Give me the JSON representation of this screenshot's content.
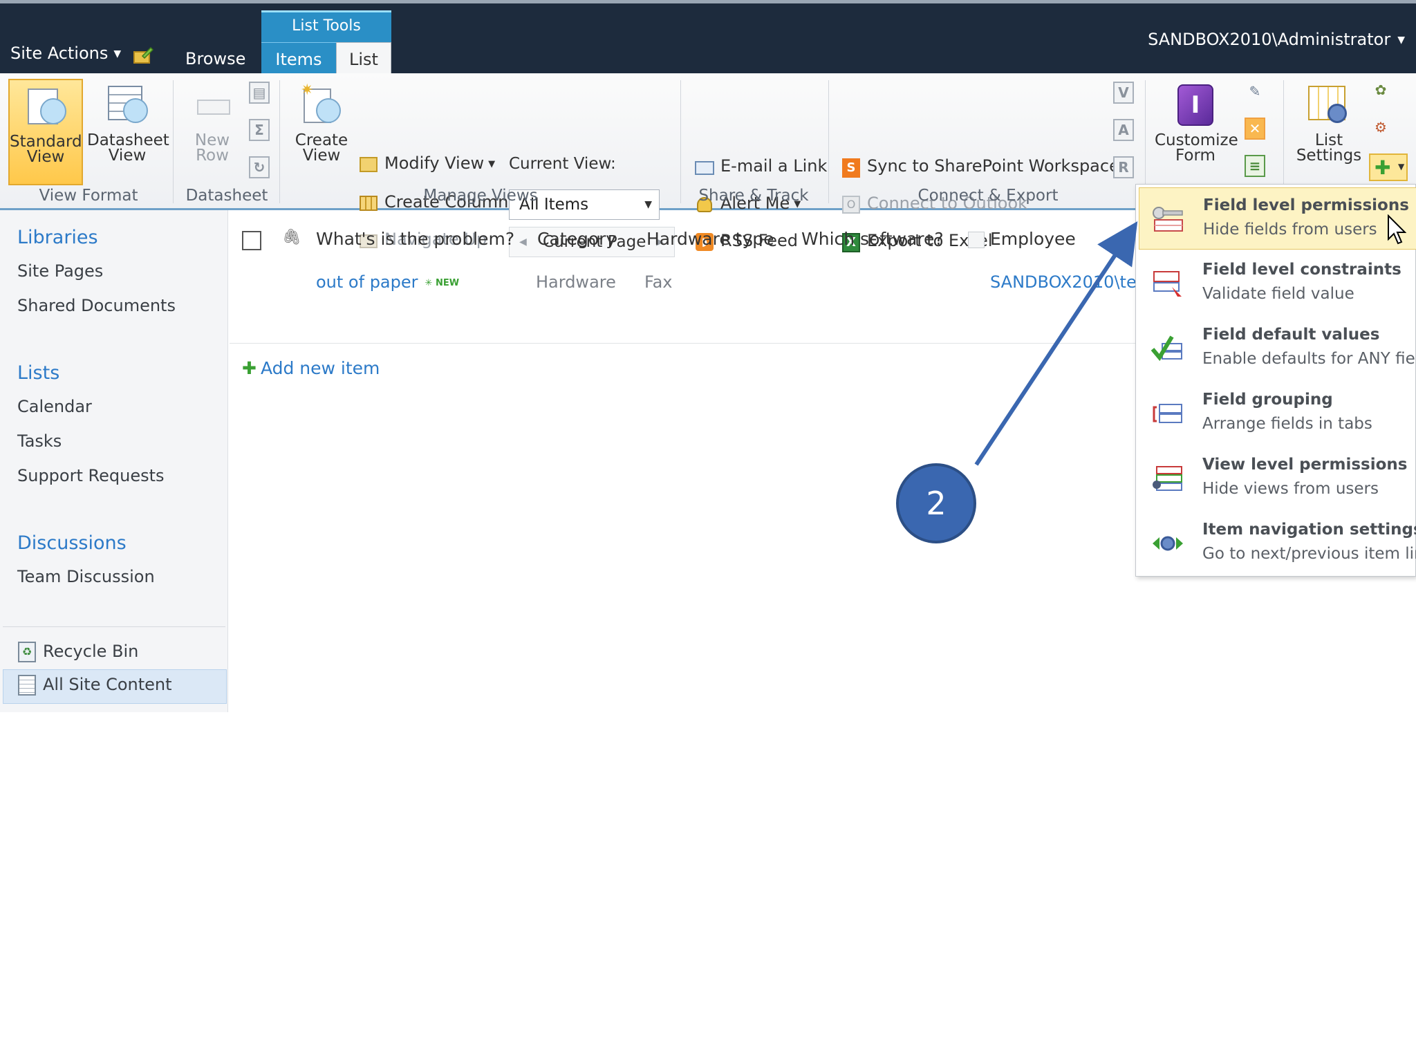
{
  "topbar": {
    "site_actions": "Site Actions",
    "browse": "Browse",
    "list_tools": "List Tools",
    "tab_items": "Items",
    "tab_list": "List",
    "user": "SANDBOX2010\\Administrator"
  },
  "ribbon": {
    "view_format": {
      "label": "View Format",
      "standard_view": "Standard View",
      "datasheet_view": "Datasheet View"
    },
    "datasheet": {
      "label": "Datasheet",
      "new_row": "New Row"
    },
    "manage_views": {
      "label": "Manage Views",
      "create_view": "Create View",
      "modify_view": "Modify View",
      "create_column": "Create Column",
      "navigate_up": "Navigate Up",
      "current_view_label": "Current View:",
      "current_view_value": "All Items",
      "current_page": "Current Page"
    },
    "share_track": {
      "label": "Share & Track",
      "email_link": "E-mail a Link",
      "alert_me": "Alert Me",
      "rss_feed": "RSS Feed"
    },
    "connect_export": {
      "label": "Connect & Export",
      "sync": "Sync to SharePoint Workspace",
      "connect_outlook": "Connect to Outlook",
      "export_excel": "Export to Excel"
    },
    "customize_form": "Customize Form",
    "list_settings": "List Settings"
  },
  "leftnav": {
    "libraries": "Libraries",
    "site_pages": "Site Pages",
    "shared_documents": "Shared Documents",
    "lists": "Lists",
    "calendar": "Calendar",
    "tasks": "Tasks",
    "support_requests": "Support Requests",
    "discussions": "Discussions",
    "team_discussion": "Team Discussion",
    "recycle_bin": "Recycle Bin",
    "all_site_content": "All Site Content"
  },
  "list": {
    "columns": [
      "What's is the problem?",
      "Category",
      "Hardware type",
      "Which software?",
      "Employee"
    ],
    "row": {
      "title": "out of paper",
      "new_badge": "NEW",
      "category": "Hardware",
      "hardware_type": "Fax",
      "employee": "SANDBOX2010\\te"
    },
    "add_new_item": "Add new item"
  },
  "menu": {
    "items": [
      {
        "title": "Field level permissions",
        "subtitle": "Hide fields from users"
      },
      {
        "title": "Field level constraints",
        "subtitle": "Validate field value"
      },
      {
        "title": "Field default values",
        "subtitle": "Enable defaults for ANY field"
      },
      {
        "title": "Field grouping",
        "subtitle": "Arrange fields in tabs"
      },
      {
        "title": "View level permissions",
        "subtitle": "Hide views from users"
      },
      {
        "title": "Item navigation settings",
        "subtitle": "Go to next/previous item link"
      }
    ]
  },
  "annotation": {
    "callout_number": "2"
  },
  "colors": {
    "topbar": "#1d2b3d",
    "tab_active": "#2a8fc6",
    "link": "#2c7ac8",
    "callout": "#3a67b0",
    "menu_highlight": "#fdf3c4"
  }
}
